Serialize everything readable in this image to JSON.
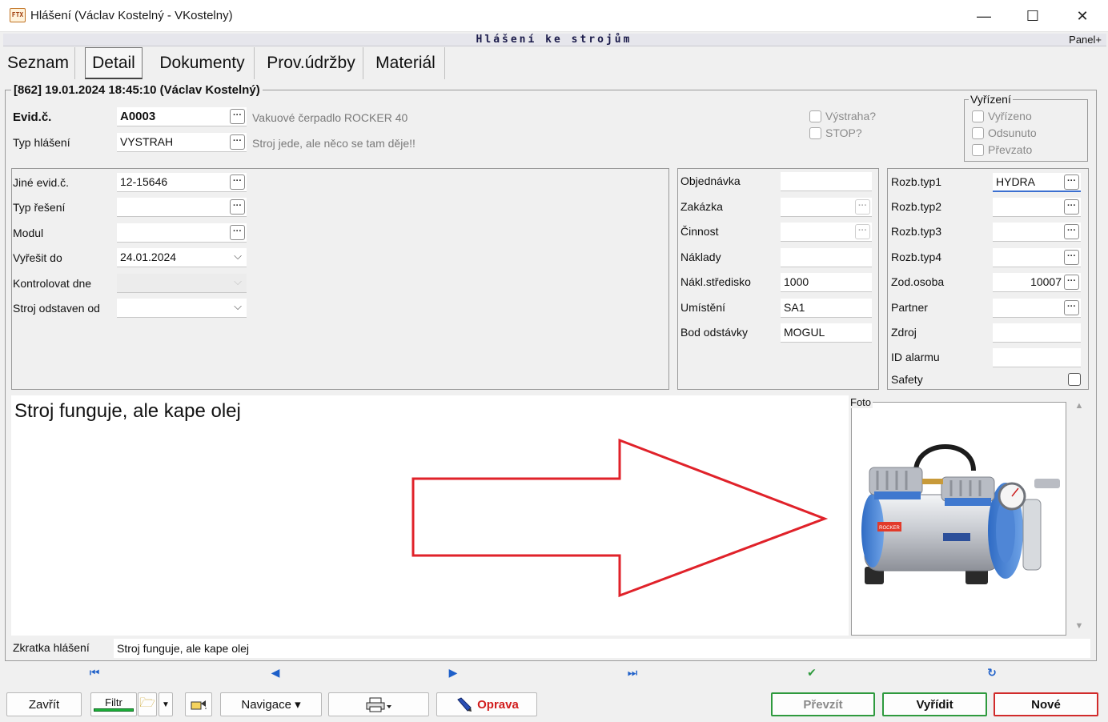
{
  "window": {
    "title": "Hlášení (Václav Kostelný - VKostelny)",
    "app_icon_text": "FTX",
    "minimize": "—",
    "maximize": "☐",
    "close": "✕"
  },
  "header": {
    "module_title": "Hlášení ke strojům",
    "panel_toggle": "Panel+"
  },
  "tabs": [
    {
      "label": "Seznam"
    },
    {
      "label": "Detail",
      "active": true
    },
    {
      "label": "Dokumenty"
    },
    {
      "label": "Prov.údržby"
    },
    {
      "label": "Materiál"
    }
  ],
  "record": {
    "header": "[862] 19.01.2024 18:45:10 (Václav Kostelný)"
  },
  "top": {
    "evid_label": "Evid.č.",
    "evid_value": "A0003",
    "evid_desc": "Vakuové čerpadlo ROCKER 40",
    "typ_label": "Typ hlášení",
    "typ_value": "VYSTRAH",
    "typ_desc": "Stroj jede, ale něco se tam děje!!",
    "vystraha_label": "Výstraha?",
    "stop_label": "STOP?"
  },
  "vyrizeni": {
    "title": "Vyřízení",
    "items": [
      "Vyřízeno",
      "Odsunuto",
      "Převzato"
    ]
  },
  "left_fields": [
    {
      "label": "Jiné evid.č.",
      "value": "12-15646",
      "kind": "ellipsis"
    },
    {
      "label": "Typ řešení",
      "value": "",
      "kind": "ellipsis"
    },
    {
      "label": "Modul",
      "value": "",
      "kind": "ellipsis"
    },
    {
      "label": "Vyřešit do",
      "value": "24.01.2024",
      "kind": "dropdown"
    },
    {
      "label": "Kontrolovat dne",
      "value": "",
      "kind": "dropdown-disabled"
    },
    {
      "label": "Stroj odstaven od",
      "value": "",
      "kind": "dropdown"
    }
  ],
  "middle_fields": [
    {
      "label": "Objednávka",
      "value": ""
    },
    {
      "label": "Zakázka",
      "value": "",
      "kind": "ellipsis-dim"
    },
    {
      "label": "Činnost",
      "value": "",
      "kind": "ellipsis-dim"
    },
    {
      "label": "Náklady",
      "value": ""
    },
    {
      "label": "Nákl.středisko",
      "value": "1000"
    },
    {
      "label": "Umístění",
      "value": "SA1"
    },
    {
      "label": "Bod odstávky",
      "value": "MOGUL"
    }
  ],
  "right_fields": [
    {
      "label": "Rozb.typ1",
      "value": "HYDRA",
      "kind": "ellipsis",
      "focused": true
    },
    {
      "label": "Rozb.typ2",
      "value": "",
      "kind": "ellipsis"
    },
    {
      "label": "Rozb.typ3",
      "value": "",
      "kind": "ellipsis"
    },
    {
      "label": "Rozb.typ4",
      "value": "",
      "kind": "ellipsis"
    },
    {
      "label": "Zod.osoba",
      "value": "10007",
      "kind": "ellipsis",
      "align": "right"
    },
    {
      "label": "Partner",
      "value": "",
      "kind": "ellipsis"
    },
    {
      "label": "Zdroj",
      "value": ""
    },
    {
      "label": "ID alarmu",
      "value": ""
    }
  ],
  "safety_label": "Safety",
  "memo": {
    "text": "Stroj funguje, ale kape olej"
  },
  "foto": {
    "label": "Foto",
    "brand_text": "ROCKER"
  },
  "shortcut": {
    "label": "Zkratka hlášení",
    "value": "Stroj funguje, ale kape olej"
  },
  "nav_icons": [
    "first-record-icon",
    "prev-record-icon",
    "next-record-icon",
    "last-record-icon",
    "confirm-check-icon",
    "refresh-icon"
  ],
  "buttons": {
    "zavrit": "Zavřít",
    "filtr": "Filtr",
    "navigace": "Navigace ▾",
    "oprava": "Oprava",
    "prevzit": "Převzít",
    "vyridit": "Vyřídit",
    "nove": "Nové"
  },
  "colors": {
    "accent_blue": "#1d5fc9",
    "confirm_green": "#2e9a3e",
    "danger_red": "#d12b2b",
    "arrow_red": "#e0222a"
  }
}
